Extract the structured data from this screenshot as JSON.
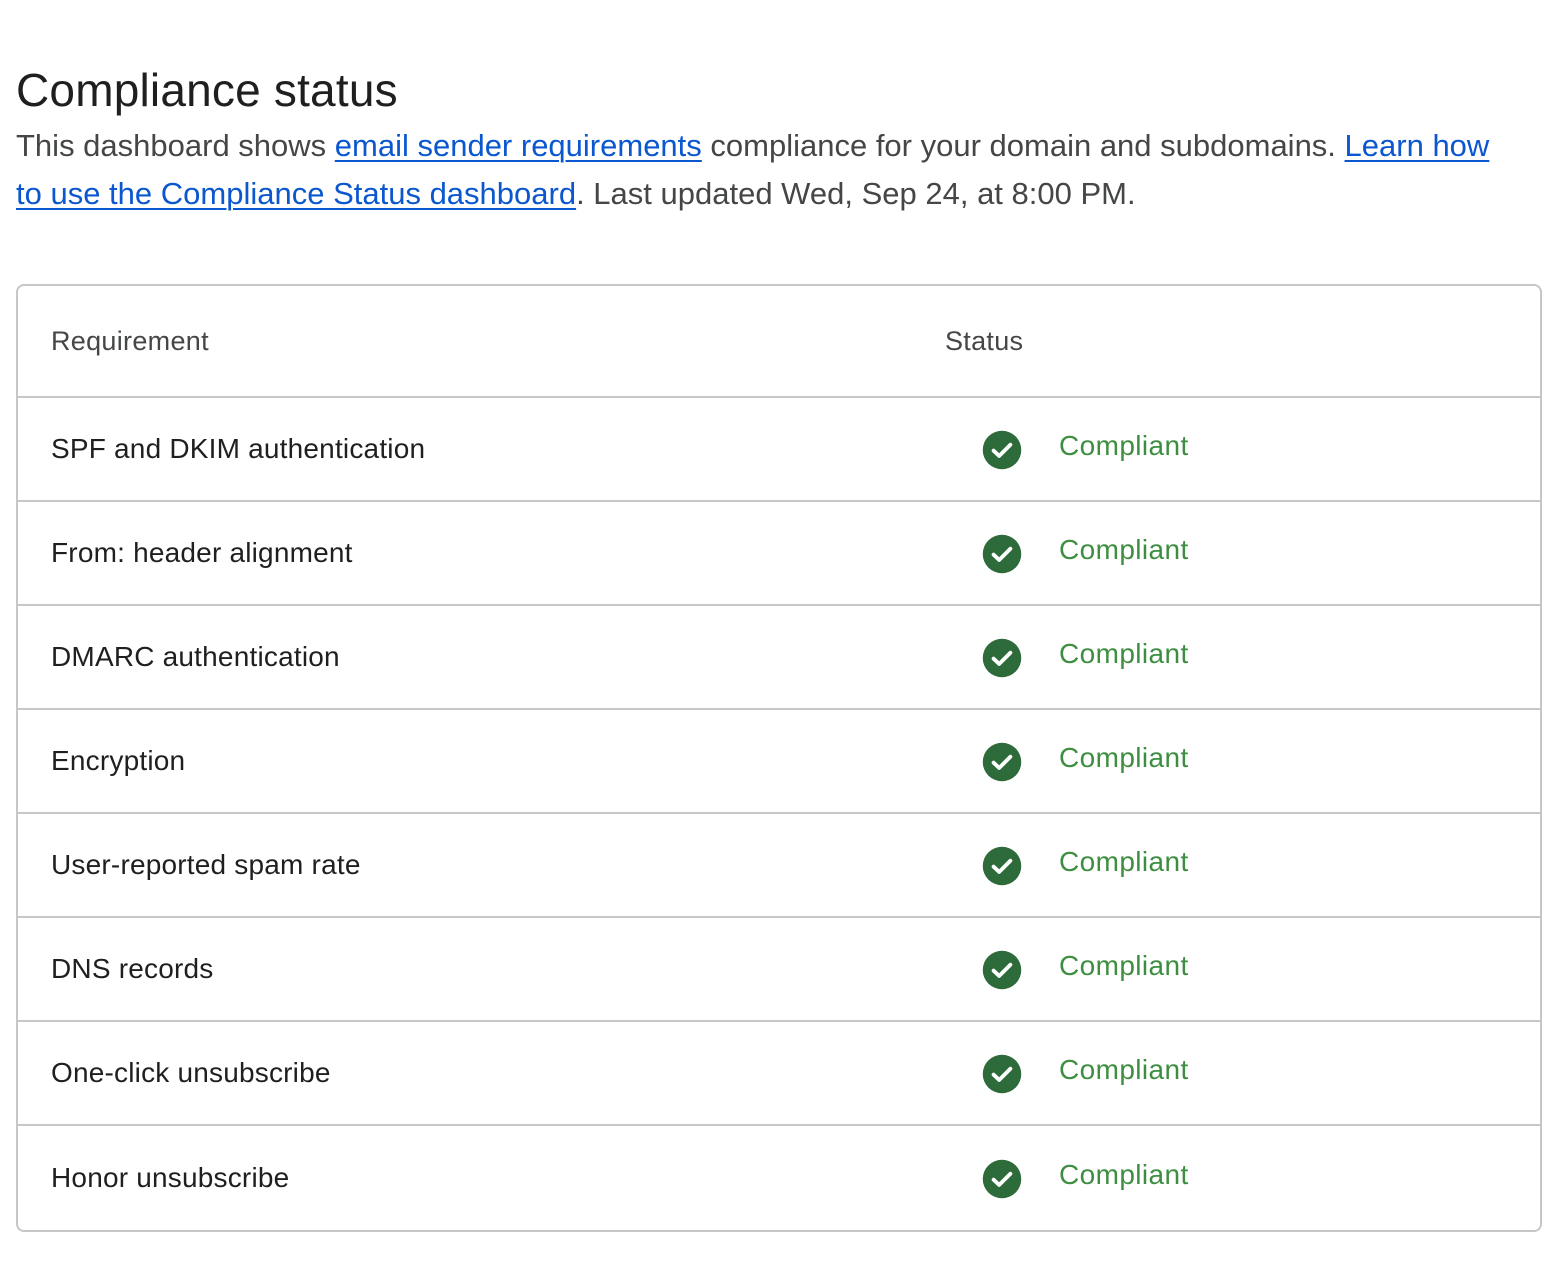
{
  "header": {
    "title": "Compliance status",
    "description": {
      "prefix": "This dashboard shows ",
      "link1_text": "email sender requirements",
      "middle": " compliance for your domain and subdomains. ",
      "link2_text": "Learn how to use the Compliance Status dashboard",
      "suffix": ". Last updated Wed, Sep 24, at 8:00 PM."
    }
  },
  "table": {
    "columns": [
      "Requirement",
      "Status"
    ],
    "rows": [
      {
        "requirement": "SPF and DKIM authentication",
        "status": "Compliant"
      },
      {
        "requirement": "From: header alignment",
        "status": "Compliant"
      },
      {
        "requirement": "DMARC authentication",
        "status": "Compliant"
      },
      {
        "requirement": "Encryption",
        "status": "Compliant"
      },
      {
        "requirement": "User-reported spam rate",
        "status": "Compliant"
      },
      {
        "requirement": "DNS records",
        "status": "Compliant"
      },
      {
        "requirement": "One-click unsubscribe",
        "status": "Compliant"
      },
      {
        "requirement": "Honor unsubscribe",
        "status": "Compliant"
      }
    ]
  },
  "icons": {
    "status": "check-circle-icon"
  },
  "colors": {
    "compliant_icon": "#2e6b3a",
    "compliant_text": "#3e8e41",
    "link": "#0b57d0"
  }
}
